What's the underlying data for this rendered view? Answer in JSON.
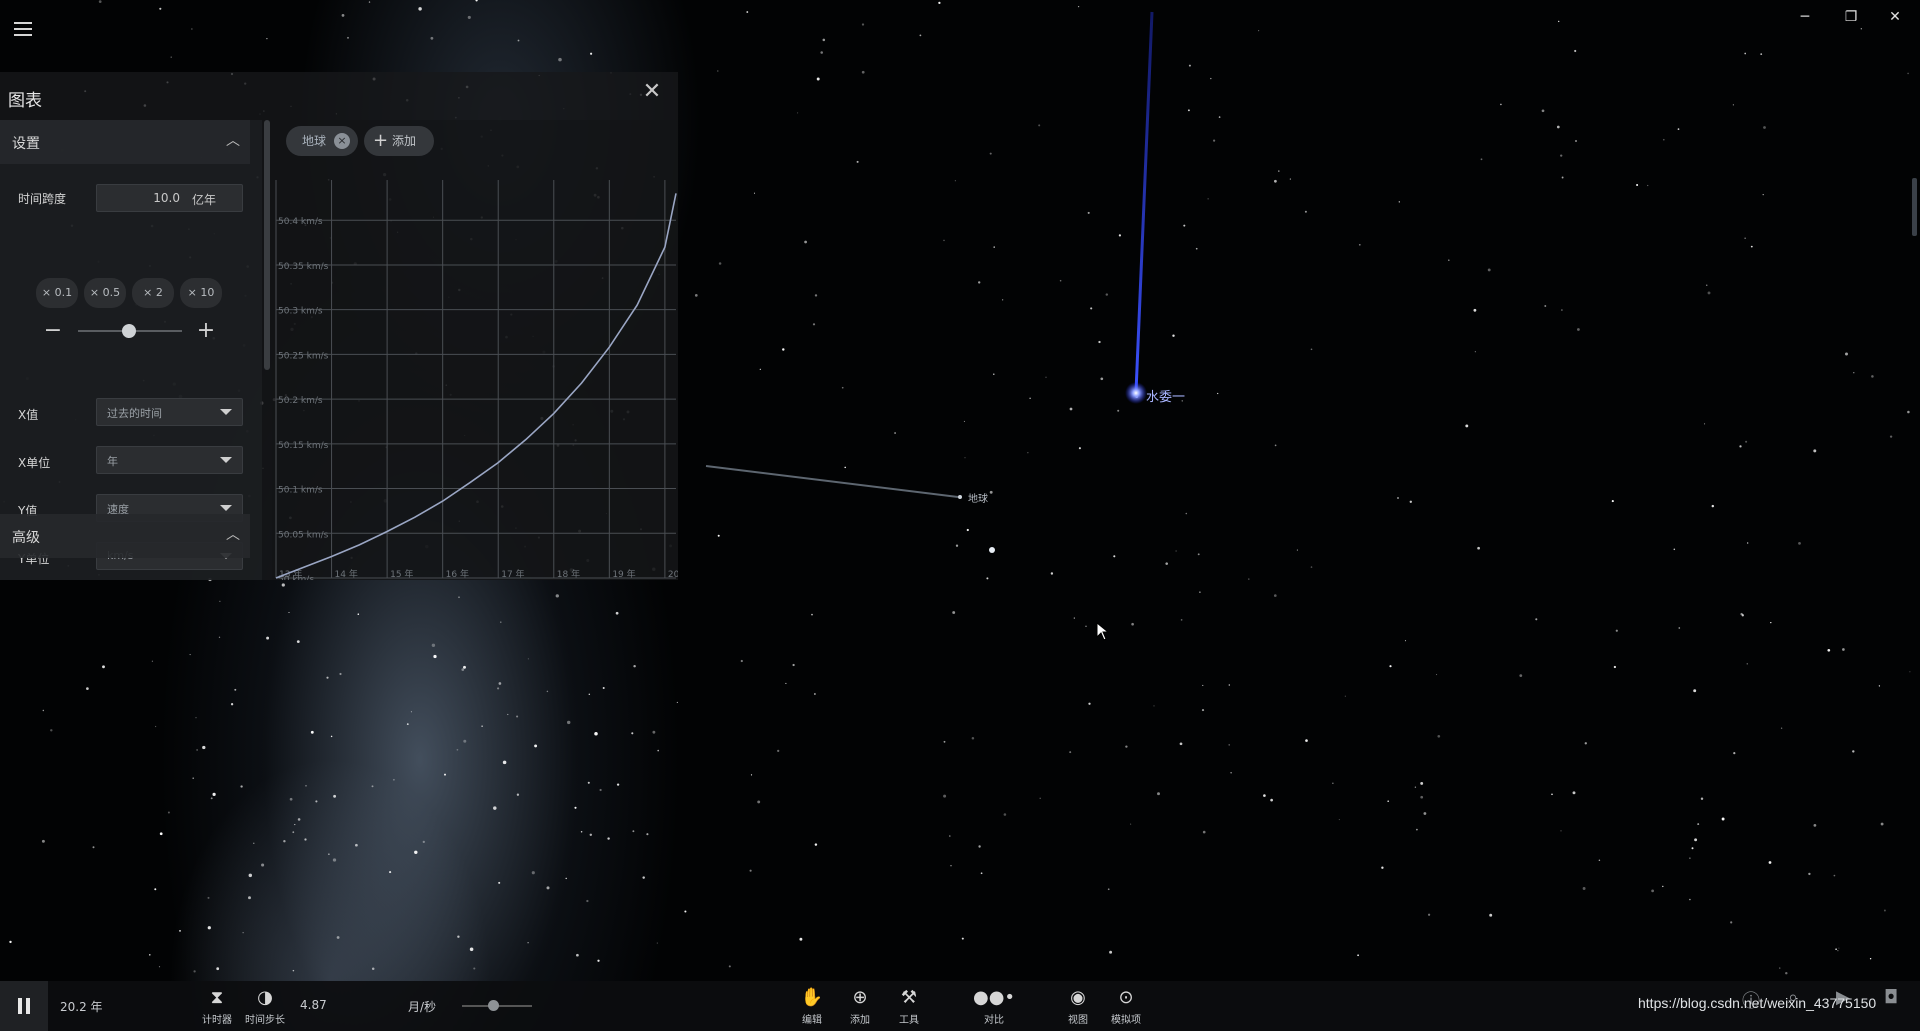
{
  "window": {
    "menu_icon": "hamburger-icon",
    "minimize": "─",
    "restore": "❐",
    "close": "✕"
  },
  "chart_panel": {
    "title": "图表",
    "close": "✕",
    "settings": {
      "header": "设置",
      "time_span_label": "时间跨度",
      "time_span_value": "10.0",
      "time_span_unit": "亿年",
      "multipliers": [
        "× 0.1",
        "× 0.5",
        "× 2",
        "× 10"
      ],
      "minus": "−",
      "plus": "+",
      "slider_level": 0.5,
      "x_value_label": "X值",
      "x_value": "过去的时间",
      "x_unit_label": "X单位",
      "x_unit": "年",
      "y_value_label": "Y值",
      "y_value": "速度",
      "y_unit_label": "Y单位",
      "y_unit": "km/s"
    },
    "advanced": {
      "header": "高级"
    },
    "chips": {
      "earth": "地球",
      "earth_remove": "×",
      "add_plus": "+",
      "add": "添加"
    }
  },
  "chart_data": {
    "type": "line",
    "title": "",
    "xlabel": "",
    "ylabel": "",
    "x_ticks": [
      "13 年",
      "14 年",
      "15 年",
      "16 年",
      "17 年",
      "18 年",
      "19 年",
      "20"
    ],
    "y_ticks": [
      "50 km/s",
      "50.05 km/s",
      "50.1 km/s",
      "50.15 km/s",
      "50.2 km/s",
      "50.25 km/s",
      "50.3 km/s",
      "50.35 km/s",
      "50.4 km/s"
    ],
    "xlim": [
      13,
      20.2
    ],
    "ylim": [
      50.0,
      50.445
    ],
    "grid": true,
    "series": [
      {
        "x": [
          13.0,
          13.5,
          14.0,
          14.5,
          15.0,
          15.5,
          16.0,
          16.5,
          17.0,
          17.5,
          18.0,
          18.5,
          19.0,
          19.5,
          20.0,
          20.2
        ],
        "y": [
          50.0,
          50.012,
          50.024,
          50.037,
          50.052,
          50.068,
          50.086,
          50.107,
          50.129,
          50.155,
          50.184,
          50.218,
          50.258,
          50.305,
          50.37,
          50.43
        ]
      }
    ]
  },
  "scene": {
    "star_label": "水委一",
    "earth_label": "地球"
  },
  "toolbar": {
    "pause_icon": "pause-icon",
    "elapsed": "20.2 年",
    "timer_label": "计时器",
    "step_label": "时间步长",
    "step_value": "4.87",
    "rate_unit": "月/秒",
    "rate_level": 0.4,
    "tools": [
      {
        "icon": "hand-icon",
        "label": "编辑"
      },
      {
        "icon": "add-circle-icon",
        "label": "添加"
      },
      {
        "icon": "tools-icon",
        "label": "工具"
      },
      {
        "icon": "compare-icon",
        "label": "对比"
      },
      {
        "icon": "eye-icon",
        "label": "视图"
      },
      {
        "icon": "simulation-icon",
        "label": "模拟项"
      }
    ],
    "watermark": "https://blog.csdn.net/weixin_43775150"
  }
}
